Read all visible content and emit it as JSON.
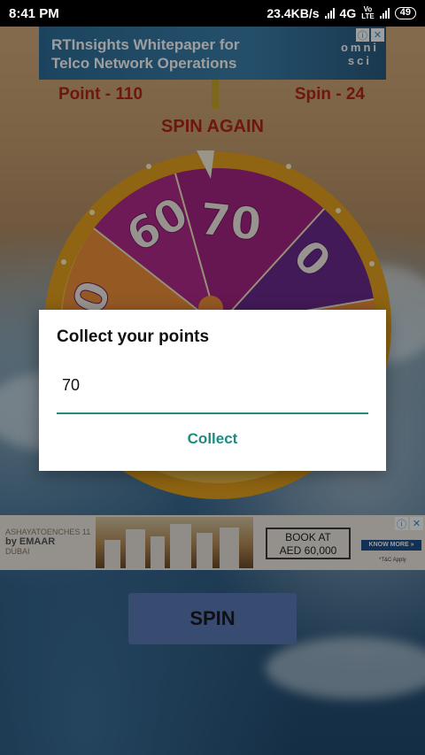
{
  "status_bar": {
    "time": "8:41 PM",
    "network_speed": "23.4KB/s",
    "network_type": "4G",
    "volte_label": "Vo\nLTE",
    "battery": "49"
  },
  "ad_top": {
    "line1": "RTInsights Whitepaper for",
    "line2": "Telco Network Operations",
    "brand": "omni\nsci",
    "info_icon": "info-icon",
    "close_icon": "close-icon"
  },
  "game": {
    "points_label": "Point - 110",
    "spins_label": "Spin - 24",
    "spin_again": "SPIN AGAIN",
    "wheel_segments": [
      "0",
      "60",
      "70",
      "0"
    ]
  },
  "dialog": {
    "title": "Collect your points",
    "value": "70",
    "action": "Collect"
  },
  "ad_bottom": {
    "brand_line1": "ASHAYATOENCHES 11",
    "brand_line2": "by EMAAR",
    "brand_line3": "DUBAI",
    "offer": "BOOK AT\nAED 60,000",
    "cta": "KNOW MORE »",
    "note": "*T&C Apply"
  },
  "spin_button": {
    "label": "SPIN"
  },
  "colors": {
    "score_red": "#b3241c",
    "accent_teal": "#1f8a80",
    "spin_button": "#5b7bb8",
    "wheel_rim": "#e7a21e",
    "wheel_magenta": "#a52482",
    "wheel_purple": "#6b2a8e",
    "wheel_orange": "#f0913a"
  }
}
